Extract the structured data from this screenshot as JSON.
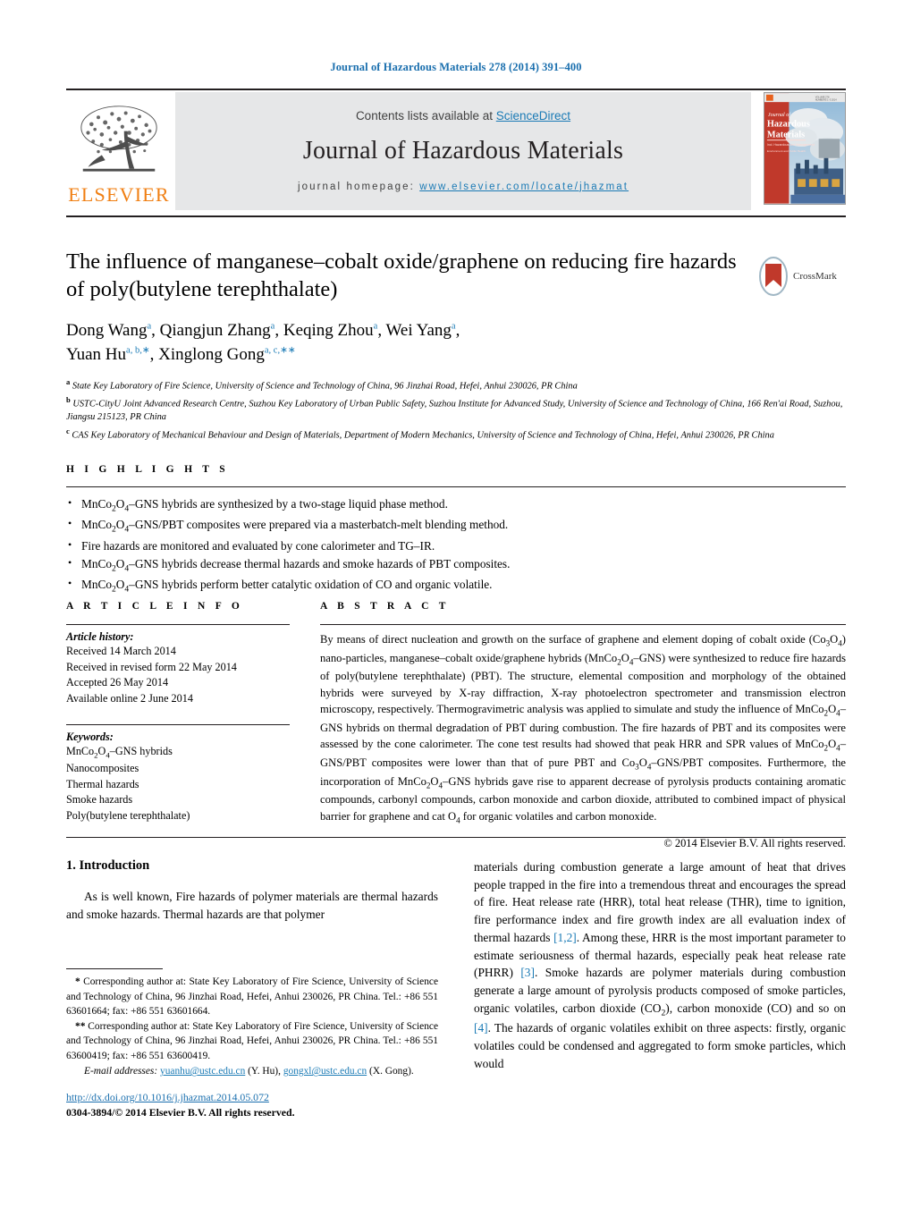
{
  "running_head": "Journal of Hazardous Materials 278 (2014) 391–400",
  "masthead": {
    "contents_prefix": "Contents lists available at ",
    "sciencedirect": "ScienceDirect",
    "journal_name": "Journal of Hazardous Materials",
    "homepage_prefix": "journal homepage: ",
    "homepage_url": "www.elsevier.com/locate/jhazmat",
    "publisher": "ELSEVIER",
    "cover_title_line1": "Journal of",
    "cover_title_line2": "Hazardous",
    "cover_title_line3": "Materials",
    "accent_blue": "#1a7ab5",
    "elsevier_orange": "#f07f13"
  },
  "article": {
    "title": "The influence of manganese–cobalt oxide/graphene on reducing fire hazards of poly(butylene terephthalate)",
    "crossmark_label": "CrossMark",
    "authors_html": "Dong Wang<sup>a</sup>, Qiangjun Zhang<sup>a</sup>, Keqing Zhou<sup>a</sup>, Wei Yang<sup>a</sup>,<br>Yuan Hu<sup class=\"star\">a, b,<span>∗</span></sup>, Xinglong Gong<sup class=\"star\">a, c,<span>∗∗</span></sup>",
    "affiliations": [
      {
        "label": "a",
        "text": "State Key Laboratory of Fire Science, University of Science and Technology of China, 96 Jinzhai Road, Hefei, Anhui 230026, PR China"
      },
      {
        "label": "b",
        "text": "USTC-CityU Joint Advanced Research Centre, Suzhou Key Laboratory of Urban Public Safety, Suzhou Institute for Advanced Study, University of Science and Technology of China, 166 Ren'ai Road, Suzhou, Jiangsu 215123, PR China"
      },
      {
        "label": "c",
        "text": "CAS Key Laboratory of Mechanical Behaviour and Design of Materials, Department of Modern Mechanics, University of Science and Technology of China, Hefei, Anhui 230026, PR China"
      }
    ]
  },
  "highlights": {
    "heading": "H I G H L I G H T S",
    "items_html": [
      "MnCo<sub class=\"sm\">2</sub>O<sub class=\"sm\">4</sub>–GNS hybrids are synthesized by a two-stage liquid phase method.",
      "MnCo<sub class=\"sm\">2</sub>O<sub class=\"sm\">4</sub>–GNS/PBT composites were prepared via a masterbatch-melt blending method.",
      "Fire hazards are monitored and evaluated by cone calorimeter and TG–IR.",
      "MnCo<sub class=\"sm\">2</sub>O<sub class=\"sm\">4</sub>–GNS hybrids decrease thermal hazards and smoke hazards of PBT composites.",
      "MnCo<sub class=\"sm\">2</sub>O<sub class=\"sm\">4</sub>–GNS hybrids perform better catalytic oxidation of CO and organic volatile."
    ]
  },
  "article_info": {
    "heading": "A R T I C L E    I N F O",
    "history_label": "Article history:",
    "history": [
      "Received 14 March 2014",
      "Received in revised form 22 May 2014",
      "Accepted 26 May 2014",
      "Available online 2 June 2014"
    ],
    "keywords_label": "Keywords:",
    "keywords_html": [
      "MnCo<sub class=\"sm\">2</sub>O<sub class=\"sm\">4</sub>–GNS hybrids",
      "Nanocomposites",
      "Thermal hazards",
      "Smoke hazards",
      "Poly(butylene terephthalate)"
    ]
  },
  "abstract": {
    "heading": "A B S T R A C T",
    "body_html": "By means of direct nucleation and growth on the surface of graphene and element doping of cobalt oxide (Co<sub class=\"sm\">3</sub>O<sub class=\"sm\">4</sub>) nano-particles, manganese–cobalt oxide/graphene hybrids (MnCo<sub class=\"sm\">2</sub>O<sub class=\"sm\">4</sub>–GNS) were synthesized to reduce fire hazards of poly(butylene terephthalate) (PBT). The structure, elemental composition and morphology of the obtained hybrids were surveyed by X-ray diffraction, X-ray photoelectron spectrometer and transmission electron microscopy, respectively. Thermogravimetric analysis was applied to simulate and study the influence of MnCo<sub class=\"sm\">2</sub>O<sub class=\"sm\">4</sub>–GNS hybrids on thermal degradation of PBT during combustion. The fire hazards of PBT and its composites were assessed by the cone calorimeter. The cone test results had showed that peak HRR and SPR values of MnCo<sub class=\"sm\">2</sub>O<sub class=\"sm\">4</sub>–GNS/PBT composites were lower than that of pure PBT and Co<sub class=\"sm\">3</sub>O<sub class=\"sm\">4</sub>–GNS/PBT composites. Furthermore, the incorporation of MnCo<sub class=\"sm\">2</sub>O<sub class=\"sm\">4</sub>–GNS hybrids gave rise to apparent decrease of pyrolysis products containing aromatic compounds, carbonyl compounds, carbon monoxide and carbon dioxide, attributed to combined impact of physical barrier for graphene and cat O<sub class=\"sm\">4</sub> for organic volatiles and carbon monoxide.",
    "copyright": "© 2014 Elsevier B.V. All rights reserved."
  },
  "introduction": {
    "heading": "1.  Introduction",
    "left_paragraph": "As is well known, Fire hazards of polymer materials are thermal hazards and smoke hazards. Thermal hazards are that polymer",
    "right_paragraph_html": "materials during combustion generate a large amount of heat that drives people trapped in the fire into a tremendous threat and encourages the spread of fire. Heat release rate (HRR), total heat release (THR), time to ignition, fire performance index and fire growth index are all evaluation index of thermal hazards <span class=\"ref\">[1,2]</span>. Among these, HRR is the most important parameter to estimate seriousness of thermal hazards, especially peak heat release rate (PHRR) <span class=\"ref\">[3]</span>. Smoke hazards are polymer materials during combustion generate a large amount of pyrolysis products composed of smoke particles, organic volatiles, carbon dioxide (CO<sub class=\"sm\">2</sub>), carbon monoxide (CO) and so on <span class=\"ref\">[4]</span>. The hazards of organic volatiles exhibit on three aspects: firstly, organic volatiles could be condensed and aggregated to form smoke particles, which would"
  },
  "footnotes": {
    "first_html": "<b>*</b>  Corresponding author at: State Key Laboratory of Fire Science, University of Science and Technology of China, 96 Jinzhai Road, Hefei, Anhui 230026, PR China. Tel.: +86 551 63601664; fax: +86 551 63601664.",
    "second_html": "<b>**</b>  Corresponding author at: State Key Laboratory of Fire Science, University of Science and Technology of China, 96 Jinzhai Road, Hefei, Anhui 230026, PR China. Tel.: +86 551 63600419; fax: +86 551 63600419.",
    "email_label": "E-mail addresses:",
    "email1": "yuanhu@ustc.edu.cn",
    "email1_owner": "(Y. Hu),",
    "email2": "gongxl@ustc.edu.cn",
    "email2_owner": "(X. Gong)."
  },
  "footer": {
    "doi": "http://dx.doi.org/10.1016/j.jhazmat.2014.05.072",
    "issn_line": "0304-3894/© 2014 Elsevier B.V. All rights reserved."
  }
}
